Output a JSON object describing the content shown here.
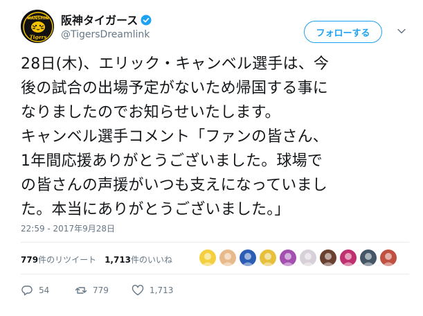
{
  "account": {
    "display_name": "阪神タイガース",
    "handle": "@TigersDreamlink",
    "avatar_text_top": "HANSHIN",
    "avatar_text_bottom": "Tigers",
    "follow_label": "フォロー​する"
  },
  "tweet": {
    "lines": [
      "28日(木)、エリック・キャンベル選手は、今",
      "後の試合の出場予定がないため帰国する事に",
      "なりましたのでお知らせいたします。",
      "キャンベル選手コメント「ファンの皆さん、",
      "1年間応援ありがとうございました。球場で",
      "の皆さんの声援がいつも支えになっていまし",
      "た。本当にありがとうございました。」"
    ],
    "timestamp": "22:59 - 2017年9月28日"
  },
  "stats": {
    "retweets_count": "779",
    "retweets_label": "件のリツイート",
    "likes_count": "1,713",
    "likes_label": "件のいいね"
  },
  "likers": [
    {
      "icon": "liker-avatar-tigers",
      "bg": "#f4d03f"
    },
    {
      "icon": "liker-avatar-face",
      "bg": "#e8b98a"
    },
    {
      "icon": "liker-avatar-mascot",
      "bg": "#2b5db5"
    },
    {
      "icon": "liker-avatar-character",
      "bg": "#e6c03a"
    },
    {
      "icon": "liker-avatar-person",
      "bg": "#a34fb0"
    },
    {
      "icon": "liker-avatar-photo",
      "bg": "#d8d0d8"
    },
    {
      "icon": "liker-avatar-woman",
      "bg": "#6a4030"
    },
    {
      "icon": "liker-avatar-group",
      "bg": "#c03070"
    },
    {
      "icon": "liker-avatar-team",
      "bg": "#445566"
    },
    {
      "icon": "liker-avatar-girl",
      "bg": "#c05040"
    }
  ],
  "actions": {
    "reply_count": "54",
    "retweet_count": "779",
    "like_count": "1,713"
  },
  "colors": {
    "accent": "#1da1f2",
    "muted": "#657786",
    "text": "#14171a",
    "divider": "#e6ecf0"
  }
}
